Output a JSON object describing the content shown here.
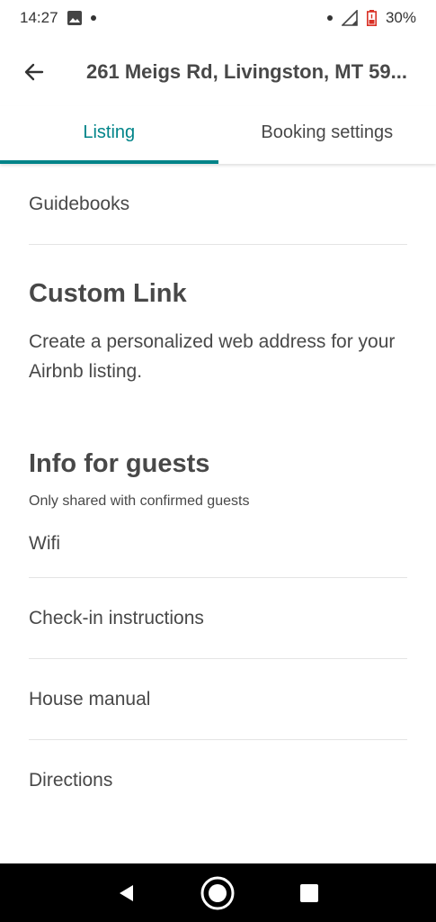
{
  "status_bar": {
    "time": "14:27",
    "battery": "30%"
  },
  "header": {
    "title": "261 Meigs Rd, Livingston, MT 59..."
  },
  "tabs": [
    {
      "label": "Listing",
      "active": true
    },
    {
      "label": "Booking settings",
      "active": false
    }
  ],
  "content": {
    "guidebooks": "Guidebooks",
    "custom_link": {
      "title": "Custom Link",
      "description": "Create a personalized web address for your Airbnb listing."
    },
    "info_for_guests": {
      "title": "Info for guests",
      "subtitle": "Only shared with confirmed guests",
      "items": [
        "Wifi",
        "Check-in instructions",
        "House manual",
        "Directions"
      ]
    }
  },
  "colors": {
    "accent": "#008489",
    "text": "#484848",
    "divider": "#e4e4e4"
  }
}
